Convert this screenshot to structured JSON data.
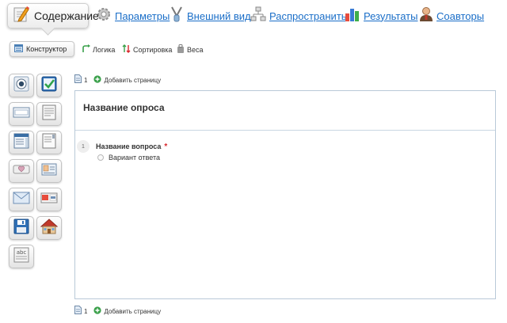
{
  "nav": {
    "active": "Содержание",
    "links": [
      "Параметры",
      "Внешний вид",
      "Распространить",
      "Результаты",
      "Соавторы"
    ]
  },
  "subnav": {
    "active": "Конструктор",
    "links": [
      "Логика",
      "Сортировка",
      "Веса"
    ]
  },
  "palette": {
    "items": [
      "radio-button-icon",
      "checkbox-icon",
      "text-field-icon",
      "text-area-icon",
      "dropdown-list-icon",
      "list-box-icon",
      "slider-rating-icon",
      "contact-card-icon",
      "email-icon",
      "date-icon",
      "save-icon",
      "home-icon",
      "text-label-icon"
    ],
    "text_label": "abc"
  },
  "page_top": {
    "number": "1",
    "add_label": "Добавить страницу"
  },
  "page_bottom": {
    "number": "1",
    "add_label": "Добавить страницу"
  },
  "survey": {
    "title": "Название опроса",
    "question": {
      "number": "1",
      "title": "Название вопроса",
      "required_mark": "*",
      "answer": "Вариант ответа"
    }
  },
  "colors": {
    "link": "#1a6ec8",
    "required": "#d9262b",
    "canvas_border": "#b9c9d8"
  }
}
